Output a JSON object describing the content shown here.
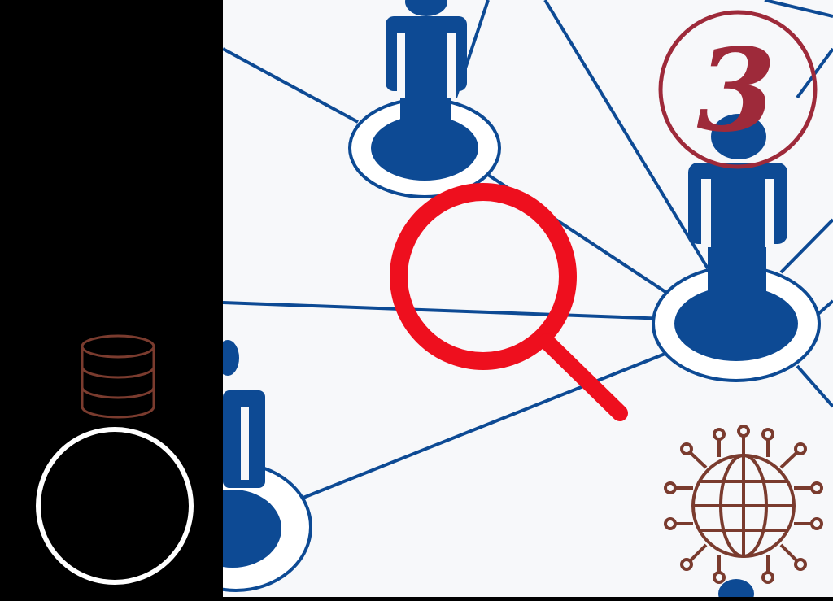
{
  "step_badge": {
    "number": "3",
    "color": "#9e2a3a"
  },
  "colors": {
    "network_blue": "#0d4a94",
    "magnifier_red": "#ee0f1e",
    "icon_brown": "#7a3b2e",
    "ring_white": "#ffffff",
    "panel_black": "#000000"
  },
  "icons": [
    "database-icon",
    "circle-button-icon",
    "network-graph-icon",
    "magnifier-icon",
    "globe-network-icon",
    "step-number-badge"
  ]
}
